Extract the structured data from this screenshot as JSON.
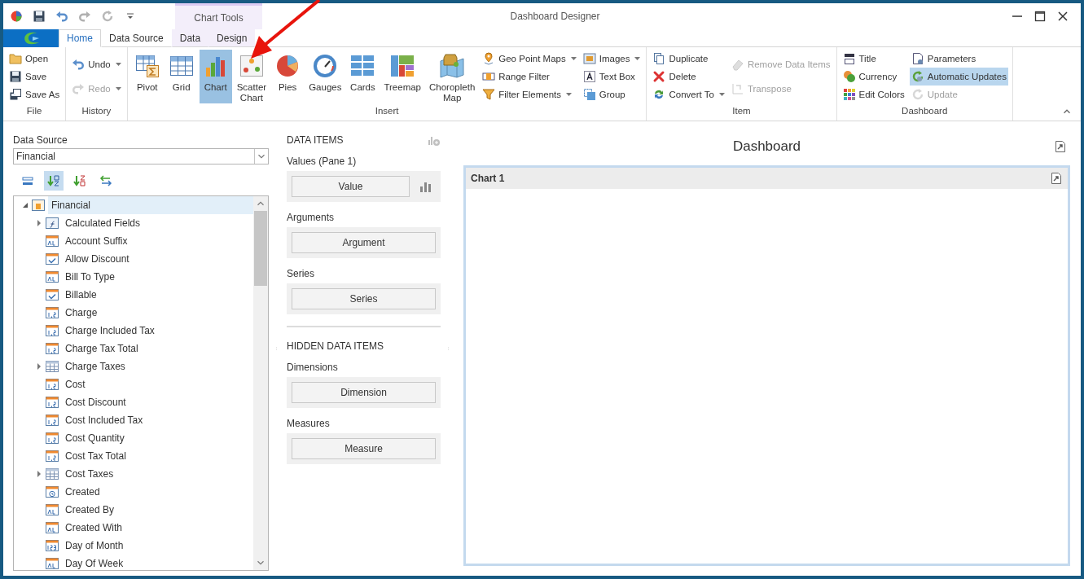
{
  "title_bar": {
    "title": "Dashboard Designer",
    "context_label": "Chart Tools"
  },
  "tabs": [
    {
      "label": "Home",
      "selected": true,
      "kind": "main"
    },
    {
      "label": "Data Source",
      "selected": false,
      "kind": "main"
    },
    {
      "label": "Data",
      "selected": false,
      "kind": "context"
    },
    {
      "label": "Design",
      "selected": false,
      "kind": "context"
    }
  ],
  "ribbon": {
    "groups": [
      {
        "label": "File",
        "columns": [
          {
            "kind": "stack",
            "items": [
              {
                "label": "Open",
                "selected": false,
                "disabled": false,
                "dropdown": false
              },
              {
                "label": "Save",
                "selected": false,
                "disabled": false,
                "dropdown": false
              },
              {
                "label": "Save As",
                "selected": false,
                "disabled": false,
                "dropdown": false
              }
            ]
          }
        ]
      },
      {
        "label": "History",
        "columns": [
          {
            "kind": "stack",
            "items": [
              {
                "label": "Undo",
                "selected": false,
                "disabled": false,
                "dropdown": true
              },
              {
                "label": "Redo",
                "selected": false,
                "disabled": true,
                "dropdown": true
              }
            ]
          }
        ]
      },
      {
        "label": "Insert",
        "columns": [
          {
            "kind": "large",
            "items": [
              {
                "label": "Pivot",
                "selected": false,
                "disabled": false
              }
            ]
          },
          {
            "kind": "large",
            "items": [
              {
                "label": "Grid",
                "selected": false,
                "disabled": false
              }
            ]
          },
          {
            "kind": "large",
            "items": [
              {
                "label": "Chart",
                "selected": true,
                "disabled": false
              }
            ]
          },
          {
            "kind": "large",
            "items": [
              {
                "label": "Scatter Chart",
                "selected": false,
                "disabled": false
              }
            ]
          },
          {
            "kind": "large",
            "items": [
              {
                "label": "Pies",
                "selected": false,
                "disabled": false
              }
            ]
          },
          {
            "kind": "large",
            "items": [
              {
                "label": "Gauges",
                "selected": false,
                "disabled": false
              }
            ]
          },
          {
            "kind": "large",
            "items": [
              {
                "label": "Cards",
                "selected": false,
                "disabled": false
              }
            ]
          },
          {
            "kind": "large",
            "items": [
              {
                "label": "Treemap",
                "selected": false,
                "disabled": false
              }
            ]
          },
          {
            "kind": "large",
            "items": [
              {
                "label": "Choropleth Map",
                "selected": false,
                "disabled": false
              }
            ]
          },
          {
            "kind": "stack",
            "items": [
              {
                "label": "Geo Point Maps",
                "selected": false,
                "disabled": false,
                "dropdown": true
              },
              {
                "label": "Range Filter",
                "selected": false,
                "disabled": false,
                "dropdown": false
              },
              {
                "label": "Filter Elements",
                "selected": false,
                "disabled": false,
                "dropdown": true
              }
            ]
          },
          {
            "kind": "stack",
            "items": [
              {
                "label": "Images",
                "selected": false,
                "disabled": false,
                "dropdown": true
              },
              {
                "label": "Text Box",
                "selected": false,
                "disabled": false,
                "dropdown": false
              },
              {
                "label": "Group",
                "selected": false,
                "disabled": false,
                "dropdown": false
              }
            ]
          }
        ]
      },
      {
        "label": "Item",
        "columns": [
          {
            "kind": "stack",
            "items": [
              {
                "label": "Duplicate",
                "selected": false,
                "disabled": false,
                "dropdown": false
              },
              {
                "label": "Delete",
                "selected": false,
                "disabled": false,
                "dropdown": false
              },
              {
                "label": "Convert To",
                "selected": false,
                "disabled": false,
                "dropdown": true
              }
            ]
          },
          {
            "kind": "stack",
            "items": [
              {
                "label": "Remove Data Items",
                "selected": false,
                "disabled": true,
                "dropdown": false
              },
              {
                "label": "Transpose",
                "selected": false,
                "disabled": true,
                "dropdown": false
              }
            ]
          }
        ]
      },
      {
        "label": "Dashboard",
        "columns": [
          {
            "kind": "stack",
            "items": [
              {
                "label": "Title",
                "selected": false,
                "disabled": false,
                "dropdown": false
              },
              {
                "label": "Currency",
                "selected": false,
                "disabled": false,
                "dropdown": false
              },
              {
                "label": "Edit Colors",
                "selected": false,
                "disabled": false,
                "dropdown": false
              }
            ]
          },
          {
            "kind": "stack",
            "items": [
              {
                "label": "Parameters",
                "selected": false,
                "disabled": false,
                "dropdown": false
              },
              {
                "label": "Automatic Updates",
                "selected": true,
                "disabled": false,
                "dropdown": false
              },
              {
                "label": "Update",
                "selected": false,
                "disabled": true,
                "dropdown": false
              }
            ]
          }
        ]
      }
    ]
  },
  "data_source_panel": {
    "label": "Data Source",
    "value": "Financial",
    "toolbar": [
      {
        "selected": false
      },
      {
        "selected": true
      },
      {
        "selected": false
      },
      {
        "selected": false
      }
    ],
    "tree": [
      {
        "label": "Financial",
        "kind": "source",
        "selected": true,
        "expanded": true,
        "children": [
          {
            "label": "Calculated Fields",
            "kind": "calc",
            "selected": false,
            "expanded": false
          },
          {
            "label": "Account Suffix",
            "kind": "text",
            "selected": false
          },
          {
            "label": "Allow Discount",
            "kind": "boolean",
            "selected": false
          },
          {
            "label": "Bill To Type",
            "kind": "text",
            "selected": false
          },
          {
            "label": "Billable",
            "kind": "boolean",
            "selected": false
          },
          {
            "label": "Charge",
            "kind": "decimal",
            "selected": false
          },
          {
            "label": "Charge Included Tax",
            "kind": "decimal",
            "selected": false
          },
          {
            "label": "Charge Tax Total",
            "kind": "decimal",
            "selected": false
          },
          {
            "label": "Charge Taxes",
            "kind": "table",
            "selected": false,
            "expanded": false
          },
          {
            "label": "Cost",
            "kind": "decimal",
            "selected": false
          },
          {
            "label": "Cost Discount",
            "kind": "decimal",
            "selected": false
          },
          {
            "label": "Cost Included Tax",
            "kind": "decimal",
            "selected": false
          },
          {
            "label": "Cost Quantity",
            "kind": "decimal",
            "selected": false
          },
          {
            "label": "Cost Tax Total",
            "kind": "decimal",
            "selected": false
          },
          {
            "label": "Cost Taxes",
            "kind": "table",
            "selected": false,
            "expanded": false
          },
          {
            "label": "Created",
            "kind": "date",
            "selected": false
          },
          {
            "label": "Created By",
            "kind": "text",
            "selected": false
          },
          {
            "label": "Created With",
            "kind": "text",
            "selected": false
          },
          {
            "label": "Day of Month",
            "kind": "integer",
            "selected": false
          },
          {
            "label": "Day Of Week",
            "kind": "text",
            "selected": false
          }
        ]
      }
    ]
  },
  "data_items_panel": {
    "sections": [
      {
        "heading": "DATA ITEMS",
        "groups": [
          {
            "label": "Values (Pane 1)",
            "button": "Value",
            "kind": "chart-type"
          },
          {
            "label": "Arguments",
            "button": "Argument",
            "kind": "plain"
          },
          {
            "label": "Series",
            "button": "Series",
            "kind": "plain"
          }
        ]
      },
      {
        "heading": "HIDDEN DATA ITEMS",
        "groups": [
          {
            "label": "Dimensions",
            "button": "Dimension",
            "kind": "plain"
          },
          {
            "label": "Measures",
            "button": "Measure",
            "kind": "plain"
          }
        ]
      }
    ]
  },
  "dashboard": {
    "title": "Dashboard",
    "items": [
      {
        "title": "Chart 1"
      }
    ]
  }
}
